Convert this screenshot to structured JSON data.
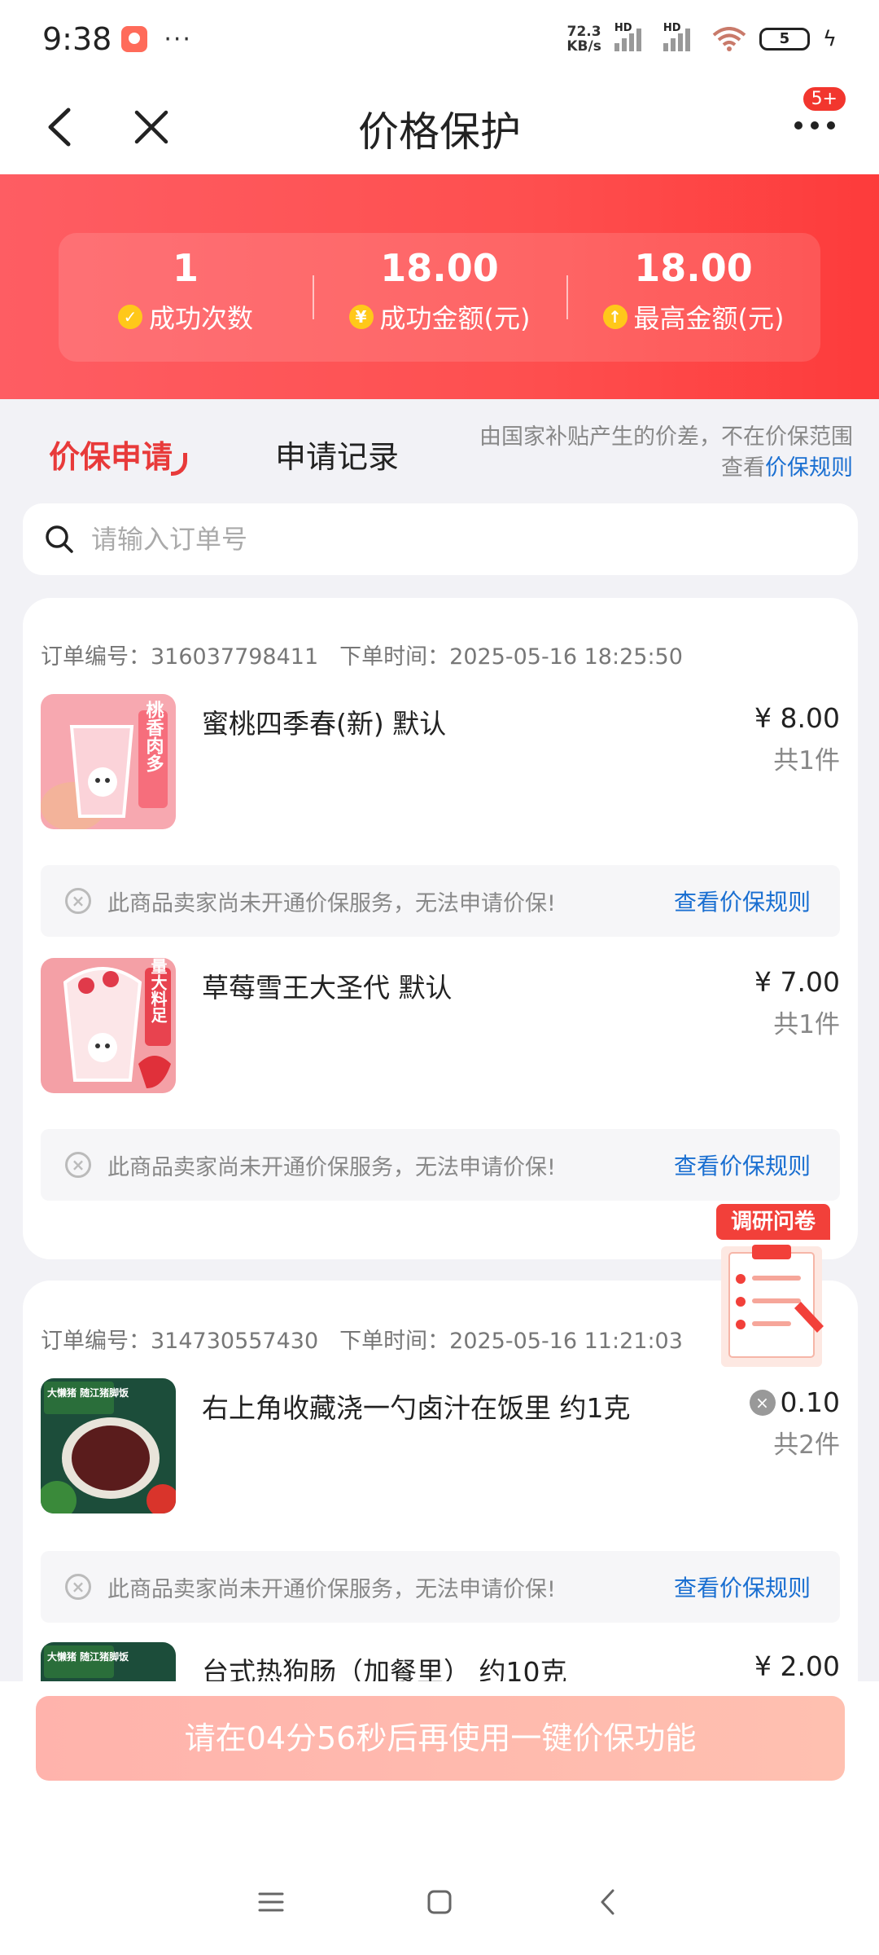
{
  "status_bar": {
    "time": "9:38",
    "more": "···",
    "net_speed_value": "72.3",
    "net_speed_unit": "KB/s",
    "signal_label_1": "HD",
    "signal_label_2": "HD",
    "battery": "5"
  },
  "header": {
    "title": "价格保护",
    "badge": "5+"
  },
  "stats": [
    {
      "value": "1",
      "label": "成功次数",
      "icon": "✓"
    },
    {
      "value": "18.00",
      "label": "成功金额(元)",
      "icon": "¥"
    },
    {
      "value": "18.00",
      "label": "最高金额(元)",
      "icon": "↑"
    }
  ],
  "tabs": {
    "active": "价保申请",
    "inactive": "申请记录"
  },
  "notice": {
    "line1": "由国家补贴产生的价差，不在价保范围",
    "line2_prefix": "查看",
    "line2_link": "价保规则"
  },
  "search": {
    "placeholder": "请输入订单号"
  },
  "orders": [
    {
      "order_no": "订单编号：316037798411",
      "order_time": "下单时间：2025-05-16 18:25:50",
      "items": [
        {
          "name": "蜜桃四季春(新) 默认",
          "price": "¥ 8.00",
          "qty": "共1件",
          "thumb_text": "桃香肉多"
        },
        {
          "name": "草莓雪王大圣代 默认",
          "price": "¥ 7.00",
          "qty": "共1件",
          "thumb_text": "量大料足"
        }
      ]
    },
    {
      "order_no": "订单编号：314730557430",
      "order_time": "下单时间：2025-05-16 11:21:03",
      "items": [
        {
          "name": "右上角收藏浇一勺卤汁在饭里 约1克",
          "price": "0.10",
          "qty": "共2件",
          "thumb_text": "大懒猪 随江猪脚饭"
        },
        {
          "name": "台式热狗肠（加餐里） 约10克",
          "price": "¥ 2.00",
          "qty": "",
          "thumb_text": "大懒猪 随江猪脚饭"
        }
      ]
    }
  ],
  "warning": {
    "text": "此商品卖家尚未开通价保服务，无法申请价保!",
    "link": "查看价保规则"
  },
  "survey": {
    "label": "调研问卷"
  },
  "cta": {
    "label": "请在04分56秒后再使用一键价保功能"
  },
  "colors": {
    "accent_red": "#e83a3a",
    "banner_red": "#fe4f4f",
    "link_blue": "#1a6fd1",
    "cta_pink": "#ffb3ac"
  }
}
